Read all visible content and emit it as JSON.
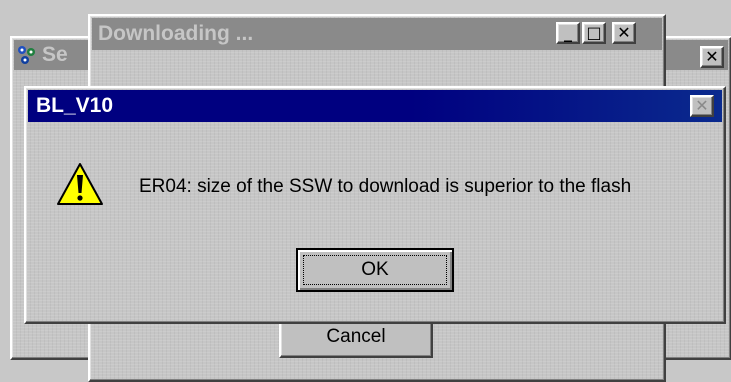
{
  "background_window": {
    "title_fragment": "Se",
    "close_glyph": "✕"
  },
  "download_window": {
    "title": "Downloading ...",
    "minimize_glyph": "_",
    "maximize_glyph": "□",
    "close_glyph": "✕",
    "cancel_label": "Cancel"
  },
  "dialog": {
    "title": "BL_V10",
    "close_glyph": "✕",
    "icon": "warning-icon",
    "message": "ER04: size of the SSW to download is superior to the flash",
    "ok_label": "OK"
  },
  "colors": {
    "active_title": "#000080",
    "inactive_title": "#8a8a8a",
    "face": "#c0c0c0",
    "warning_yellow": "#ffff00"
  }
}
